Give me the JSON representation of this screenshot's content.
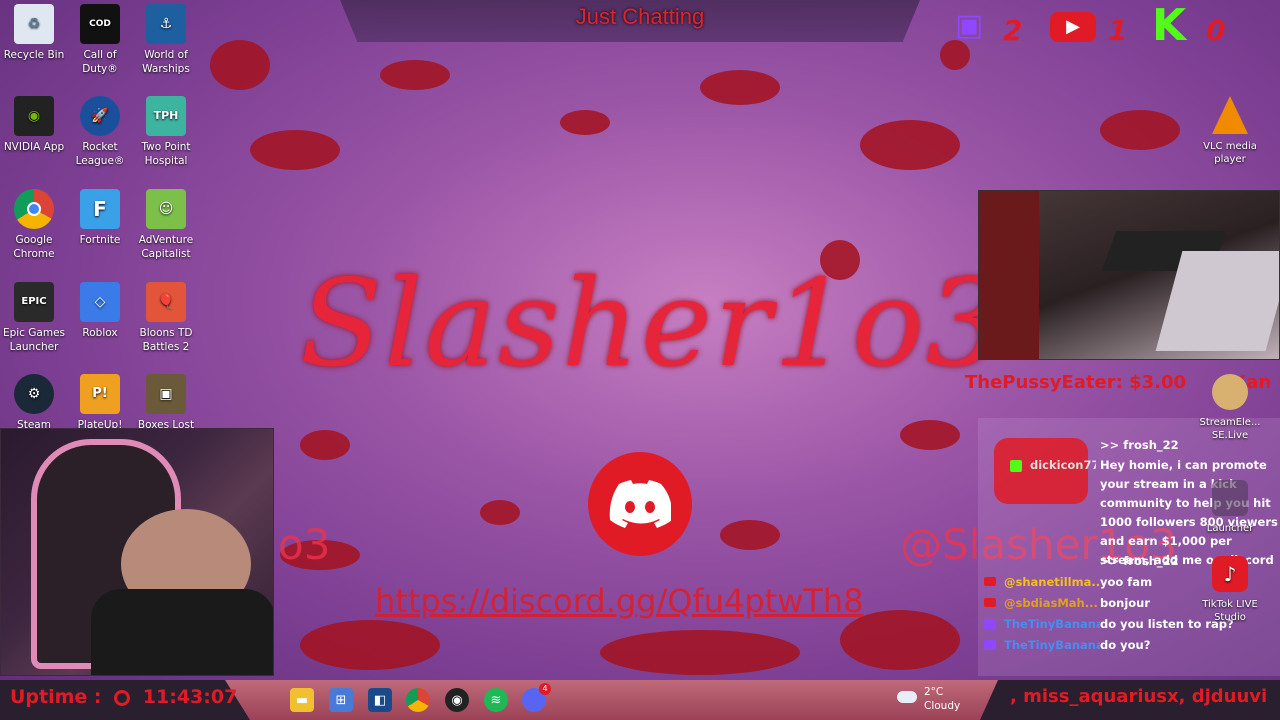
{
  "overlay": {
    "category_title": "Just Chatting",
    "brand_name": "Slasher1o3",
    "handle_left": "o3",
    "handle_right": "@Slasher1o3",
    "discord_link": "https://discord.gg/Qfu4ptwTh8",
    "donation": "ThePussyEater: $3.00",
    "donation_tail": "Kan",
    "social_counts": {
      "twitch": "2",
      "youtube": "1",
      "kick": "0"
    },
    "accent_color": "#e01b25"
  },
  "desktop_icons": [
    {
      "label": "Recycle Bin",
      "icon": "recycle-bin-icon"
    },
    {
      "label": "Call of Duty®",
      "icon": "call-of-duty-icon"
    },
    {
      "label": "World of Warships",
      "icon": "world-of-warships-icon"
    },
    {
      "label": "NVIDIA App",
      "icon": "nvidia-icon"
    },
    {
      "label": "Rocket League®",
      "icon": "rocket-league-icon"
    },
    {
      "label": "Two Point Hospital",
      "icon": "two-point-hospital-icon"
    },
    {
      "label": "Google Chrome",
      "icon": "chrome-icon"
    },
    {
      "label": "Fortnite",
      "icon": "fortnite-icon"
    },
    {
      "label": "AdVenture Capitalist",
      "icon": "adventure-capitalist-icon"
    },
    {
      "label": "Epic Games Launcher",
      "icon": "epic-games-icon"
    },
    {
      "label": "Roblox",
      "icon": "roblox-icon"
    },
    {
      "label": "Bloons TD Battles 2",
      "icon": "bloons-icon"
    },
    {
      "label": "Steam",
      "icon": "steam-icon"
    },
    {
      "label": "PlateUp!",
      "icon": "plateup-icon"
    },
    {
      "label": "Boxes Lost",
      "icon": "boxes-lost-icon"
    }
  ],
  "right_icons": [
    {
      "label": "VLC media player",
      "icon": "vlc-icon"
    },
    {
      "label": "StreamEle... SE.Live",
      "icon": "streamelements-icon"
    },
    {
      "label": "Launcher",
      "icon": "launcher-icon"
    },
    {
      "label": "TikTok LIVE Studio",
      "icon": "tiktok-icon"
    }
  ],
  "chat": [
    {
      "user": "",
      "msg": ">> frosh_22",
      "platform": ""
    },
    {
      "user": "dickicon77",
      "msg": "Hey homie, i can promote your stream in a kick community to help you hit 1000 followers 800 viewers and earn $1,000 per stream, add me on discord",
      "platform": "kick"
    },
    {
      "user": "",
      "msg": ">> frosh_22",
      "platform": ""
    },
    {
      "user": "@shanetillma...",
      "msg": "yoo fam",
      "platform": "youtube"
    },
    {
      "user": "@sbdiasMah...",
      "msg": "bonjour",
      "platform": "youtube"
    },
    {
      "user": "TheTinyBanana",
      "msg": "do you listen to rap?",
      "platform": "twitch"
    },
    {
      "user": "TheTinyBanana",
      "msg": "do you?",
      "platform": "twitch"
    }
  ],
  "taskbar": {
    "uptime_label": "Uptime :",
    "uptime_value": "11:43:07",
    "weather_temp": "2°C",
    "weather_desc": "Cloudy",
    "follows_ticker": ", miss_aquariusx, djduuvi",
    "discord_badge": "4"
  }
}
